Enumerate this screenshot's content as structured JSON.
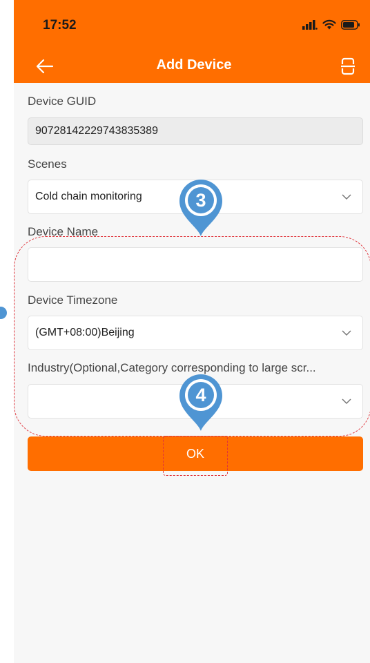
{
  "status_bar": {
    "time": "17:52"
  },
  "nav": {
    "title": "Add Device"
  },
  "form": {
    "guid_label": "Device GUID",
    "guid_value": "90728142229743835389",
    "scenes_label": "Scenes",
    "scenes_value": "Cold chain monitoring",
    "name_label": "Device Name",
    "name_value": "",
    "timezone_label": "Device Timezone",
    "timezone_value": "(GMT+08:00)Beijing",
    "industry_label": "Industry(Optional,Category corresponding to large scr...",
    "industry_value": ""
  },
  "ok_button": {
    "label": "OK"
  },
  "annotations": {
    "marker_3": "3",
    "marker_4": "4"
  },
  "colors": {
    "brand": "#ff6e00",
    "marker": "#4f95d3",
    "dashed": "#e0333a"
  },
  "icons": [
    "back-arrow-icon",
    "scan-icon",
    "signal-icon",
    "wifi-icon",
    "battery-icon",
    "chevron-down-icon"
  ]
}
